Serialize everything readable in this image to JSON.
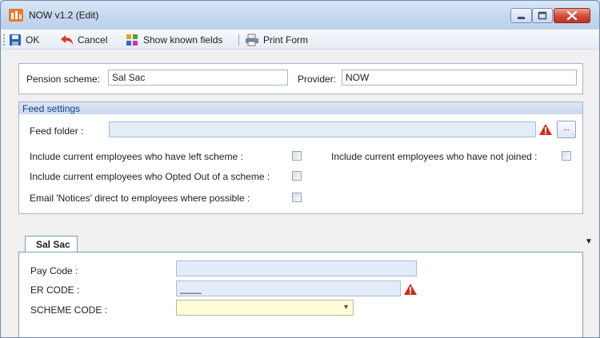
{
  "window": {
    "title": "NOW v1.2 (Edit)"
  },
  "toolbar": {
    "ok_label": "OK",
    "cancel_label": "Cancel",
    "show_fields_label": "Show known fields",
    "print_label": "Print Form"
  },
  "scheme": {
    "pension_scheme_label": "Pension scheme:",
    "pension_scheme_value": "Sal Sac",
    "provider_label": "Provider:",
    "provider_value": "NOW"
  },
  "feed_settings": {
    "header": "Feed settings",
    "feed_folder_label": "Feed folder :",
    "feed_folder_value": "",
    "browse_label": "...",
    "left_scheme_label": "Include current employees who have left scheme :",
    "not_joined_label": "Include current employees who have not joined :",
    "opted_out_label": "Include current employees who Opted Out of a scheme :",
    "email_notices_label": "Email 'Notices' direct to employees where possible :",
    "left_scheme_checked": false,
    "not_joined_checked": false,
    "opted_out_checked": false,
    "email_notices_checked": false
  },
  "tabs": [
    {
      "label": "Sal Sac",
      "active": true
    }
  ],
  "codes": {
    "pay_code_label": "Pay Code :",
    "pay_code_value": "",
    "er_code_label": "ER CODE :",
    "er_code_value": "____",
    "scheme_code_label": "SCHEME CODE :",
    "scheme_code_value": ""
  },
  "colors": {
    "field_blue": "#e3ecf9",
    "field_yellow": "#fffdd8",
    "group_header_text": "#15428b",
    "warning_red": "#d42b1e"
  }
}
